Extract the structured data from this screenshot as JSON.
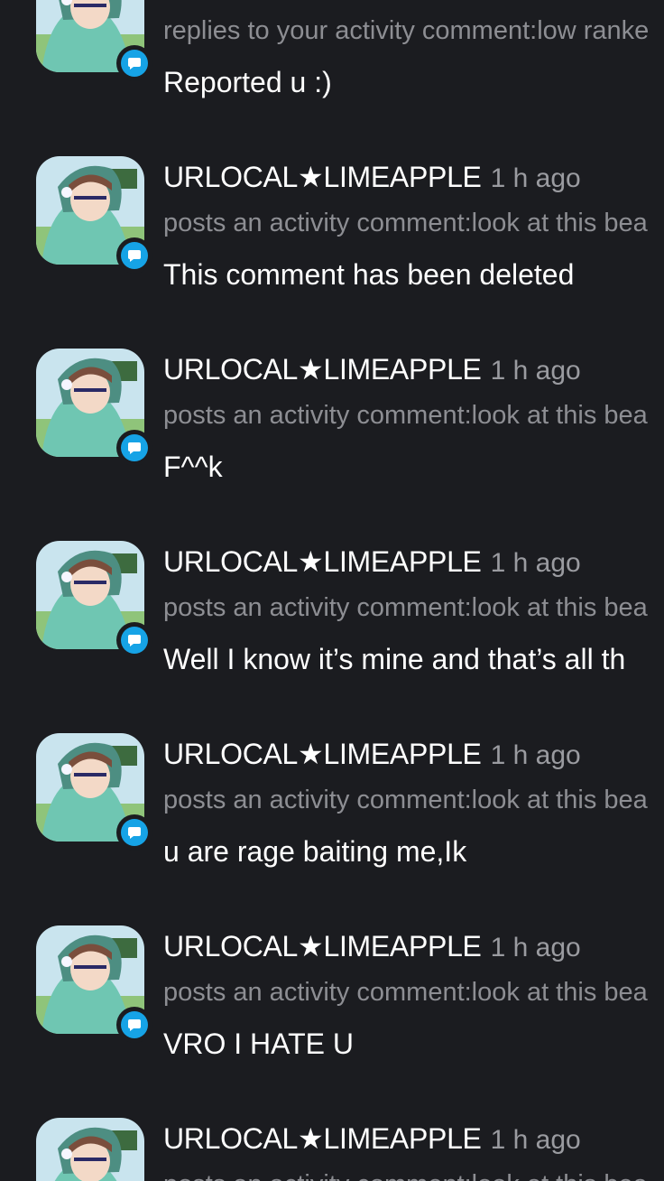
{
  "accent_color": "#16a3e6",
  "background_color": "#1b1c20",
  "notifications": [
    {
      "username": "",
      "time": "",
      "action": "replies to your activity comment:low ranke",
      "message": "Reported u :)",
      "badge_icon": "comment-bubble-icon"
    },
    {
      "username": "URLOCAL★LIMEAPPLE",
      "time": "1 h ago",
      "action": "posts an activity comment:look at this bea",
      "message": "This comment has been deleted",
      "badge_icon": "comment-bubble-icon"
    },
    {
      "username": "URLOCAL★LIMEAPPLE",
      "time": "1 h ago",
      "action": "posts an activity comment:look at this bea",
      "message": "F^^k",
      "badge_icon": "comment-bubble-icon"
    },
    {
      "username": "URLOCAL★LIMEAPPLE",
      "time": "1 h ago",
      "action": "posts an activity comment:look at this bea",
      "message": "Well I know it’s mine and that’s all th",
      "badge_icon": "comment-bubble-icon"
    },
    {
      "username": "URLOCAL★LIMEAPPLE",
      "time": "1 h ago",
      "action": "posts an activity comment:look at this bea",
      "message": "u are rage baiting me,Ik",
      "badge_icon": "comment-bubble-icon"
    },
    {
      "username": "URLOCAL★LIMEAPPLE",
      "time": "1 h ago",
      "action": "posts an activity comment:look at this bea",
      "message": "VRO I HATE U",
      "badge_icon": "comment-bubble-icon"
    },
    {
      "username": "URLOCAL★LIMEAPPLE",
      "time": "1 h ago",
      "action": "posts an activity comment:look at this bea",
      "message": "",
      "badge_icon": "comment-bubble-icon"
    }
  ]
}
